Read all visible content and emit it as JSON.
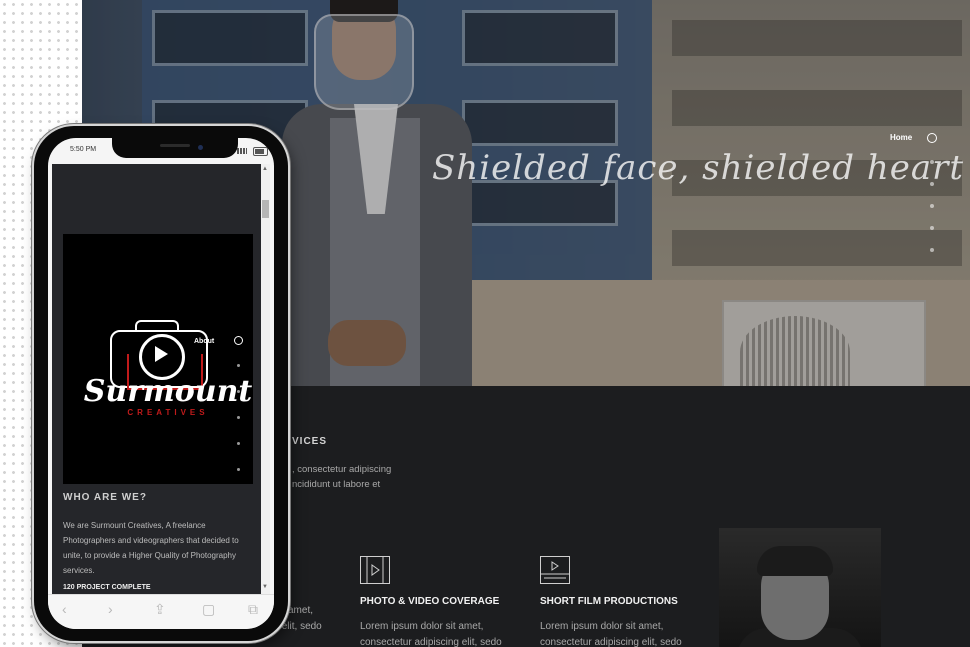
{
  "hero": {
    "tagline": "Shielded face, shielded heart . . .",
    "nav_active": "Home"
  },
  "services_section": {
    "title": "VICES",
    "intro_line1": ", consectetur adipiscing",
    "intro_line2": "ncididunt ut labore et",
    "left_col_line1": "amet,",
    "left_col_line2": "consectetur adipiscing elit, sedo",
    "items": [
      {
        "title": "PHOTO & VIDEO COVERAGE",
        "line1": "Lorem ipsum dolor sit amet,",
        "line2": "consectetur adipiscing elit, sedo",
        "icon": "film-play-icon"
      },
      {
        "title": "SHORT FILM PRODUCTIONS",
        "line1": "Lorem ipsum dolor sit amet,",
        "line2": "consectetur adipiscing elit, sedo",
        "icon": "video-player-icon"
      }
    ]
  },
  "phone": {
    "status_time": "5:50 PM",
    "logo_script": "Surmount",
    "logo_sub": "CREATIVES",
    "nav_active": "About",
    "who_title": "WHO ARE WE?",
    "who_text": "We are Surmount Creatives, A freelance Photographers and videographers that decided to unite, to provide a Higher Quality of Photography services.",
    "stat": "120 PROJECT COMPLETE",
    "toolbar": [
      "‹",
      "›",
      "⇪",
      "▢",
      "⧉"
    ]
  },
  "colors": {
    "accent_red": "#c11b1b",
    "dark_bg": "#1c1d1f"
  }
}
